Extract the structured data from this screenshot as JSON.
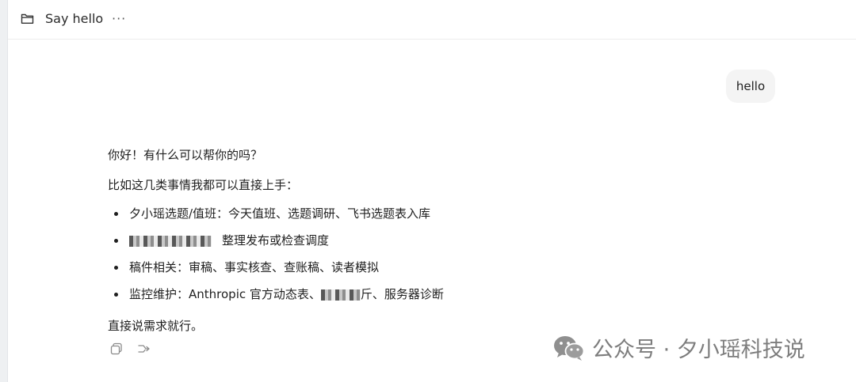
{
  "header": {
    "title": "Say hello",
    "more_label": "···"
  },
  "conversation": {
    "user_message": "hello",
    "assistant": {
      "greeting": "你好！有什么可以帮你的吗？",
      "intro": "比如这几类事情我都可以直接上手：",
      "bullets": [
        {
          "text": "夕小瑶选题/值班：今天值班、选题调研、飞书选题表入库"
        },
        {
          "visible_text": "整理发布或检查调度"
        },
        {
          "text": "稿件相关：审稿、事实核查、查账稿、读者模拟"
        },
        {
          "prefix": "监控维护：Anthropic 官方动态表、",
          "suffix": "斤、服务器诊断"
        }
      ],
      "closing": "直接说需求就行。"
    }
  },
  "watermark": {
    "text": "公众号 · 夕小瑶科技说"
  },
  "icons": {
    "folder": "folder-icon",
    "more": "more-icon",
    "copy": "copy-icon",
    "retry": "retry-icon",
    "wechat": "wechat-icon"
  }
}
